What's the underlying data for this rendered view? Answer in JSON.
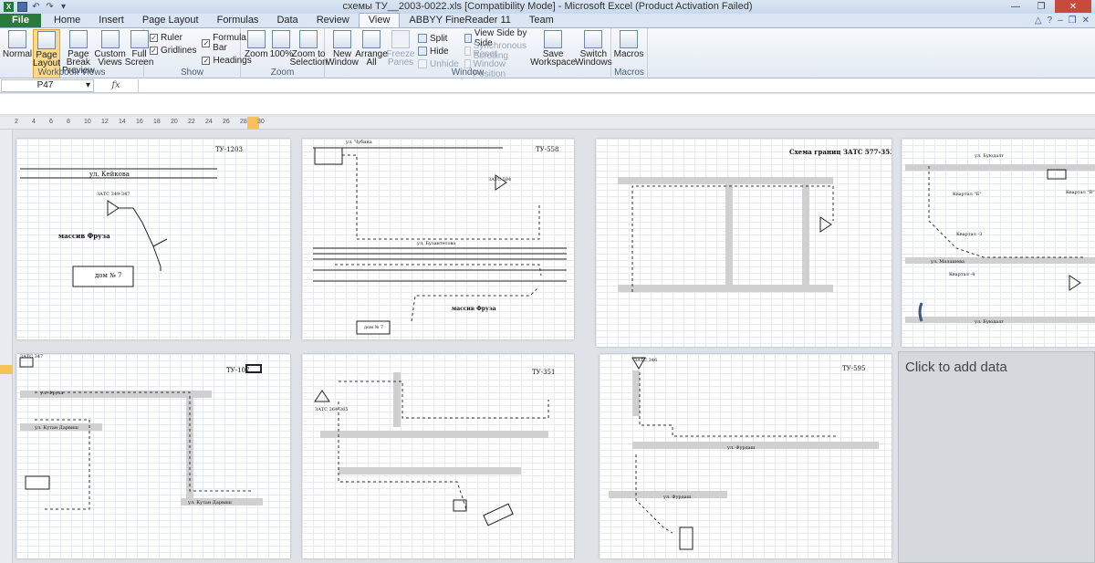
{
  "window": {
    "title": "схемы ТУ__2003-0022.xls  [Compatibility Mode]  -  Microsoft Excel (Product Activation Failed)",
    "app_icon": "excel-icon"
  },
  "tabs": [
    {
      "label": "File"
    },
    {
      "label": "Home"
    },
    {
      "label": "Insert"
    },
    {
      "label": "Page Layout"
    },
    {
      "label": "Formulas"
    },
    {
      "label": "Data"
    },
    {
      "label": "Review"
    },
    {
      "label": "View"
    },
    {
      "label": "ABBYY FineReader 11"
    },
    {
      "label": "Team"
    }
  ],
  "ribbon": {
    "workbook_views": {
      "label": "Workbook Views",
      "normal": "Normal",
      "page_layout": "Page Layout",
      "page_break": "Page Break Preview",
      "custom_views": "Custom Views",
      "full_screen": "Full Screen"
    },
    "show": {
      "label": "Show",
      "ruler": "Ruler",
      "formula_bar": "Formula Bar",
      "gridlines": "Gridlines",
      "headings": "Headings"
    },
    "zoom": {
      "label": "Zoom",
      "zoom": "Zoom",
      "hundred": "100%",
      "zoom_selection": "Zoom to Selection"
    },
    "window": {
      "label": "Window",
      "new_window": "New Window",
      "arrange_all": "Arrange All",
      "freeze_panes": "Freeze Panes",
      "split": "Split",
      "hide": "Hide",
      "unhide": "Unhide",
      "side_by_side": "View Side by Side",
      "sync_scroll": "Synchronous Scrolling",
      "reset_position": "Reset Window Position",
      "save_workspace": "Save Workspace",
      "switch_windows": "Switch Windows"
    },
    "macros": {
      "label": "Macros",
      "macros": "Macros"
    }
  },
  "formula_bar": {
    "name_box": "P47",
    "fx": "fx"
  },
  "ruler": {
    "ticks": [
      "2",
      "4",
      "6",
      "8",
      "10",
      "12",
      "14",
      "16",
      "18",
      "20",
      "22",
      "24",
      "26",
      "28",
      "30"
    ]
  },
  "pages": [
    {
      "title": "ТУ-1203",
      "labels": [
        "ул. Кейкова",
        "ЗАТС 349-347",
        "массив Фруза",
        "дом № 7"
      ]
    },
    {
      "title": "ТУ-558",
      "labels": [
        "ул. Чубина",
        "ЗАТС 584",
        "ул. Бузантетова",
        "массив Фруза",
        "дом № 7"
      ]
    },
    {
      "title": "Схема границ ЗАТС 577-353",
      "labels": []
    },
    {
      "title": "",
      "labels": [
        "ул. Буюдалг",
        "Квартал \"Б\"",
        "Квартал \"В\"",
        "Квартал -3",
        "ул. Малашева",
        "Квартал -4",
        "ул. Буюдалг"
      ]
    },
    {
      "title": "ТУ-107",
      "labels": [
        "ЗАТС 347",
        "ул. Фруза",
        "ул. Кутан Дарвиш",
        "ул. Кутан Дарвиш"
      ]
    },
    {
      "title": "ТУ-351",
      "labels": [
        "ЗАТС 364-365"
      ]
    },
    {
      "title": "ТУ-595",
      "labels": [
        "ЗАТС 346",
        "ул. Фурдаш",
        "ул. Фурдаш"
      ]
    }
  ],
  "add_data": "Click to add data"
}
